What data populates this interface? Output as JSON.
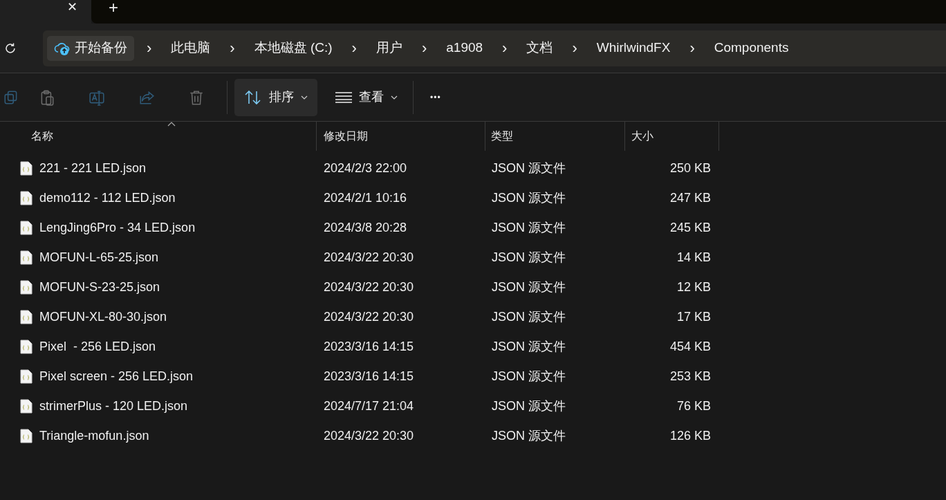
{
  "tab_bar": {
    "close_glyph": "✕",
    "new_tab_glyph": "+"
  },
  "address_bar": {
    "backup_button": "开始备份",
    "crumbs": [
      "此电脑",
      "本地磁盘 (C:)",
      "用户",
      "a1908",
      "文档",
      "WhirlwindFX",
      "Components"
    ],
    "separator": "›"
  },
  "toolbar": {
    "actions": [
      {
        "kind": "copy",
        "disabled": true
      },
      {
        "kind": "paste",
        "disabled": true
      },
      {
        "kind": "rename",
        "disabled": true
      },
      {
        "kind": "share",
        "disabled": true
      },
      {
        "kind": "delete",
        "disabled": true
      }
    ],
    "sort_button": "排序",
    "view_button": "查看",
    "more_glyph": "•••"
  },
  "table": {
    "columns": [
      "名称",
      "修改日期",
      "类型",
      "大小"
    ],
    "rows": [
      {
        "name": "221 - 221 LED.json",
        "modified": "2024/2/3 22:00",
        "type": "JSON 源文件",
        "size": "250 KB"
      },
      {
        "name": "demo112 - 112 LED.json",
        "modified": "2024/2/1 10:16",
        "type": "JSON 源文件",
        "size": "247 KB"
      },
      {
        "name": "LengJing6Pro - 34 LED.json",
        "modified": "2024/3/8 20:28",
        "type": "JSON 源文件",
        "size": "245 KB"
      },
      {
        "name": "MOFUN-L-65-25.json",
        "modified": "2024/3/22 20:30",
        "type": "JSON 源文件",
        "size": "14 KB"
      },
      {
        "name": "MOFUN-S-23-25.json",
        "modified": "2024/3/22 20:30",
        "type": "JSON 源文件",
        "size": "12 KB"
      },
      {
        "name": "MOFUN-XL-80-30.json",
        "modified": "2024/3/22 20:30",
        "type": "JSON 源文件",
        "size": "17 KB"
      },
      {
        "name": "Pixel  - 256 LED.json",
        "modified": "2023/3/16 14:15",
        "type": "JSON 源文件",
        "size": "454 KB"
      },
      {
        "name": "Pixel screen - 256 LED.json",
        "modified": "2023/3/16 14:15",
        "type": "JSON 源文件",
        "size": "253 KB"
      },
      {
        "name": "strimerPlus - 120 LED.json",
        "modified": "2024/7/17 21:04",
        "type": "JSON 源文件",
        "size": "76 KB"
      },
      {
        "name": "Triangle-mofun.json",
        "modified": "2024/3/22 20:30",
        "type": "JSON 源文件",
        "size": "126 KB"
      }
    ]
  }
}
